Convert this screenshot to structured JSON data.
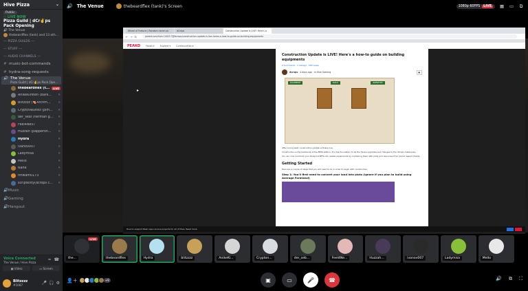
{
  "server": {
    "name": "Hive Pizza",
    "badge": "Public"
  },
  "live_now": {
    "label": "LIVE NOW",
    "title": "Pizza Guild | dCr✌️ps Pack Opening",
    "channel": "The Venue",
    "user_line": "thebeardflex (tank) and 13 oth..."
  },
  "categories": {
    "guides": "--- PIZZA GUILDS ---",
    "empty": "--- STUFF ---",
    "bots": "--- AUDIO CHANNELS ---"
  },
  "text_channels": [
    {
      "name": "music-bot-commands"
    },
    {
      "name": "hydra-song-requests"
    }
  ],
  "voice_channel": {
    "name": "The Venue",
    "sub": "Pizza Guild | dCr✌️ps Pack Ope..."
  },
  "members": [
    {
      "name": "thebeardflex (t...",
      "color": "#8a6a3a",
      "live": "LIVE",
      "bold": true
    },
    {
      "name": "AnikeKirsten (Bark...",
      "color": "#7a7a7a"
    },
    {
      "name": "Blitzzzz (🍕Archm...",
      "color": "#d69a2a"
    },
    {
      "name": "CryptoVaultez (plm...",
      "color": "#5a6a7a"
    },
    {
      "name": "der_sebi (herman g...",
      "color": "#3a5a3a"
    },
    {
      "name": "Feel4Nev7",
      "color": "#b5455a"
    },
    {
      "name": "Huzzah (papperon...",
      "color": "#6a4a8a"
    },
    {
      "name": "Hydra",
      "color": "#2a7ab5",
      "bold": true
    },
    {
      "name": "ivanov007",
      "color": "#5a5a5a"
    },
    {
      "name": "Ladymisa",
      "color": "#8abf3a"
    },
    {
      "name": "Mello",
      "color": "#c5c5c5"
    },
    {
      "name": "Nane",
      "color": "#b57a3a"
    },
    {
      "name": "nftwam0173",
      "color": "#e08a2a"
    },
    {
      "name": "scriptkitty(dcrops c...",
      "color": "#4a6a9a"
    }
  ],
  "voice_channels_bottom": [
    "Music",
    "Gaming",
    "Hangout",
    "Hangout (full)"
  ],
  "voice_panel": {
    "status": "Voice Connected",
    "sub": "The Venue / Hive Pizza",
    "video": "Video",
    "screen": "Screen"
  },
  "user": {
    "name": "Blitzzzz",
    "tag": "#1087"
  },
  "topbar": {
    "channel": "The Venue",
    "host": "thebeardflex (tank)'s Screen",
    "quality": "1080p 60FPS",
    "live": "LIVE"
  },
  "browser": {
    "tabs": [
      "Wheel of Fortune | Random name pic",
      "dCrops",
      "Construction Update is LIVE! Here's a",
      ""
    ],
    "url": "peakd.com/hive-140217/@dcrops/construction-update-is-live-heres-a-how-to-guide-on-building-equipments",
    "site_logo": "PEAKD",
    "nav": [
      "Feeds ▾",
      "Explore ▾",
      "Communities ▾"
    ]
  },
  "post": {
    "title": "Construction Update is LIVE! Here's a how-to guide on building equipments",
    "meta": "9 Comments · 1 reblogs · 266 views",
    "author": "dcrops",
    "author_meta": "4 days ago · in Hive Gaming",
    "equip_label": "EQUIPMENT",
    "build_label": "BUILD",
    "inventory_label": "INVENTORY",
    "p1": "After a long wait, construction update is finally live.",
    "p2": "Construction is the backbone of the BETA edition. It is the foundation to all the future upgrades and changes to the dCrops metaverse.",
    "p3": "You can now construct your blueprint NFTs into usable equipments by combining them with plots and resources from parcel reward chests.",
    "h2": "Getting Started",
    "p4": "Here are a couple of steps that you will need to do in order to begin with construction.",
    "h3": "Step 1: You'll first need to convert your land into plots (ignore if you plan to build using Average Farmland)"
  },
  "notif": "How to support Peak open source projects for all of Hive: Read more",
  "tiles": [
    {
      "name": "the...",
      "color": "#2f3136",
      "live": "LIVE"
    },
    {
      "name": "thebeardflex",
      "color": "#9a7a4a",
      "speaking": true
    },
    {
      "name": "Hydra",
      "color": "#b5e0f0",
      "speaking": true
    },
    {
      "name": "blitzzzz",
      "color": "#c7a05a"
    },
    {
      "name": "AnikeKi...",
      "color": "#d5d5d5"
    },
    {
      "name": "Crypton...",
      "color": "#d8dce0"
    },
    {
      "name": "der_seb...",
      "color": "#6a7a5a"
    },
    {
      "name": "Feel4Ne...",
      "color": "#e5b8b8"
    },
    {
      "name": "Huzzah...",
      "color": "#4a3a5a"
    },
    {
      "name": "ivanov007",
      "color": "#2a2a2a"
    },
    {
      "name": "Ladymisa",
      "color": "#8abf3a"
    },
    {
      "name": "Mello",
      "color": "#e8e8e8"
    }
  ],
  "viewers": {
    "count": "+9"
  },
  "colors": {
    "live": "#da373c",
    "connected": "#23a55a",
    "sidebar": "#2b2d31"
  }
}
